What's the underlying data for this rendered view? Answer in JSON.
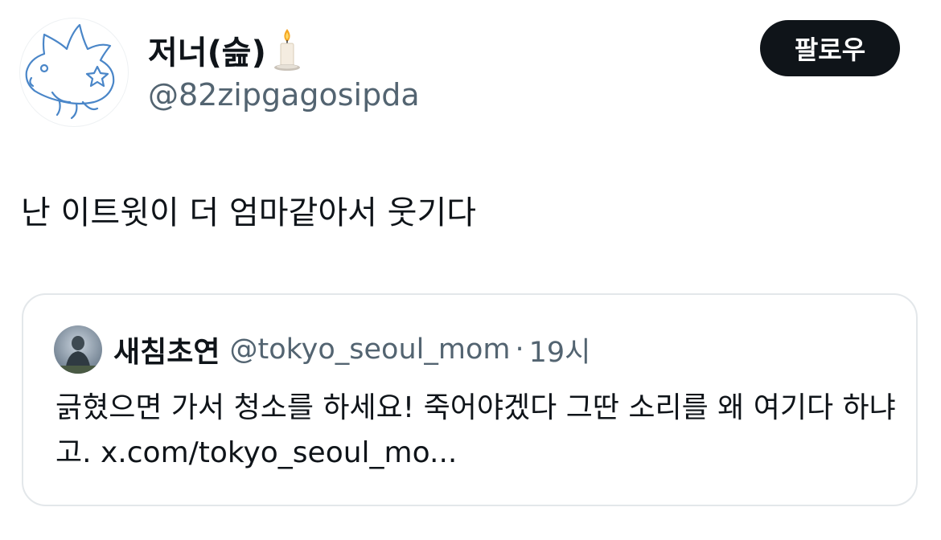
{
  "tweet": {
    "author": {
      "display_name": "저너(슲)",
      "handle": "@82zipgagosipda",
      "avatar_icon": "sunfish-doodle-avatar",
      "name_emoji_icon": "candle-icon"
    },
    "follow_label": "팔로우",
    "text": "난 이트윗이 더 엄마같아서 웃기다"
  },
  "quoted_tweet": {
    "display_name": "새침초연",
    "handle": "@tokyo_seoul_mom",
    "separator": "·",
    "time": "19시",
    "text": "긁혔으면 가서 청소를 하세요! 죽어야겠다 그딴 소리를 왜 여기다 하냐고. x.com/tokyo_seoul_mo..."
  },
  "colors": {
    "text_primary": "#0f1419",
    "text_secondary": "#536471",
    "follow_button_bg": "#0f1419",
    "card_border": "#e3e7ea"
  }
}
